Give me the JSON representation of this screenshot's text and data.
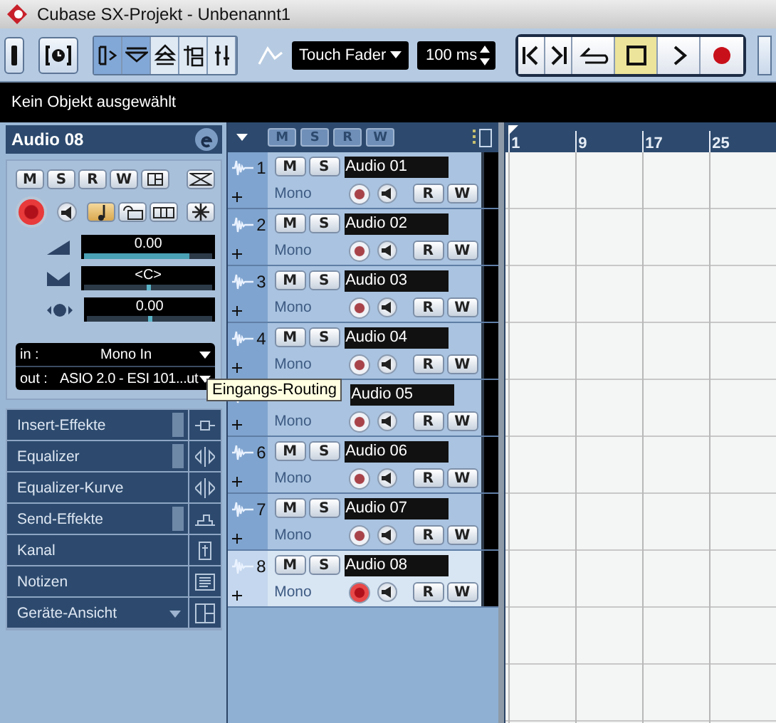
{
  "window": {
    "title": "Cubase SX-Projekt - Unbenannt1"
  },
  "toolbar": {
    "tools": [
      {
        "selected": true
      },
      {
        "selected": true
      },
      {
        "selected": false
      },
      {
        "selected": false
      },
      {
        "selected": false
      }
    ],
    "automation_mode": "Touch Fader",
    "time": "100 ms",
    "transport": [
      {
        "active": false
      },
      {
        "active": false
      },
      {
        "active": false
      },
      {
        "active": true
      },
      {
        "active": false
      },
      {
        "active": false
      }
    ]
  },
  "info_line": "Kein Objekt ausgewählt",
  "inspector": {
    "track_name": "Audio 08",
    "buttons": [
      "M",
      "S",
      "R",
      "W"
    ],
    "record_enabled": true,
    "note_button_on": true,
    "volume": {
      "reading": "0.00",
      "level": 0.82
    },
    "pan": {
      "reading": "<C>",
      "level": 0.5
    },
    "delay": {
      "reading": "0.00",
      "level": 0.5
    },
    "input": {
      "label": "in :",
      "value": "Mono In"
    },
    "output": {
      "label": "out :",
      "value": "ASIO 2.0 - ESI 101...ut"
    },
    "sections": [
      {
        "label": "Insert-Effekte",
        "active": true,
        "menu": false
      },
      {
        "label": "Equalizer",
        "active": true,
        "menu": false
      },
      {
        "label": "Equalizer-Kurve",
        "active": false,
        "menu": false
      },
      {
        "label": "Send-Effekte",
        "active": true,
        "menu": false
      },
      {
        "label": "Kanal",
        "active": false,
        "menu": false
      },
      {
        "label": "Notizen",
        "active": false,
        "menu": false
      },
      {
        "label": "Geräte-Ansicht",
        "active": false,
        "menu": true
      }
    ]
  },
  "track_list": {
    "header_buttons": [
      "M",
      "S",
      "R",
      "W"
    ],
    "tracks": [
      {
        "number": "1",
        "name": "Audio 01",
        "channel": "Mono",
        "mute": "M",
        "solo": "S",
        "read": "R",
        "write": "W",
        "selected": false,
        "record_enabled": false
      },
      {
        "number": "2",
        "name": "Audio 02",
        "channel": "Mono",
        "mute": "M",
        "solo": "S",
        "read": "R",
        "write": "W",
        "selected": false,
        "record_enabled": false
      },
      {
        "number": "3",
        "name": "Audio 03",
        "channel": "Mono",
        "mute": "M",
        "solo": "S",
        "read": "R",
        "write": "W",
        "selected": false,
        "record_enabled": false
      },
      {
        "number": "4",
        "name": "Audio 04",
        "channel": "Mono",
        "mute": "M",
        "solo": "S",
        "read": "R",
        "write": "W",
        "selected": false,
        "record_enabled": false
      },
      {
        "name": "Audio 05",
        "channel": "Mono",
        "read": "R",
        "write": "W",
        "selected": false,
        "record_enabled": false
      },
      {
        "number": "6",
        "name": "Audio 06",
        "channel": "Mono",
        "mute": "M",
        "solo": "S",
        "read": "R",
        "write": "W",
        "selected": false,
        "record_enabled": false
      },
      {
        "number": "7",
        "name": "Audio 07",
        "channel": "Mono",
        "mute": "M",
        "solo": "S",
        "read": "R",
        "write": "W",
        "selected": false,
        "record_enabled": false
      },
      {
        "number": "8",
        "name": "Audio 08",
        "channel": "Mono",
        "mute": "M",
        "solo": "S",
        "read": "R",
        "write": "W",
        "selected": true,
        "record_enabled": true
      }
    ]
  },
  "tooltip": "Eingangs-Routing",
  "ruler": {
    "marks": [
      "1",
      "9",
      "17",
      "25"
    ]
  }
}
